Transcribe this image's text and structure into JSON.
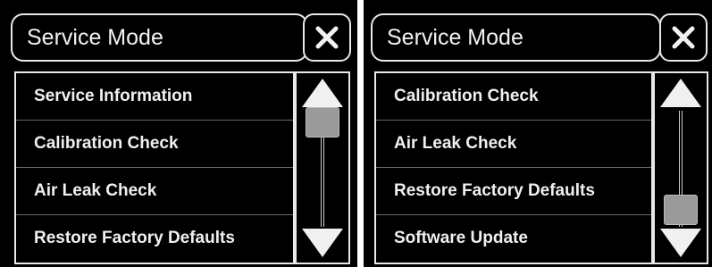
{
  "left_screen": {
    "title": "Service Mode",
    "items": [
      {
        "label": "Service Information"
      },
      {
        "label": "Calibration Check"
      },
      {
        "label": "Air Leak Check"
      },
      {
        "label": "Restore Factory Defaults"
      }
    ],
    "scroll_position": 0.0
  },
  "right_screen": {
    "title": "Service Mode",
    "items": [
      {
        "label": "Calibration Check"
      },
      {
        "label": "Air Leak Check"
      },
      {
        "label": "Restore Factory Defaults"
      },
      {
        "label": "Software Update"
      }
    ],
    "scroll_position": 1.0
  },
  "icons": {
    "close": "close-icon",
    "scroll_up": "arrow-up-icon",
    "scroll_down": "arrow-down-icon"
  },
  "colors": {
    "background": "#000000",
    "foreground": "#f0f0f0",
    "thumb": "#9a9a9a",
    "divider": "#6a6a6a"
  }
}
